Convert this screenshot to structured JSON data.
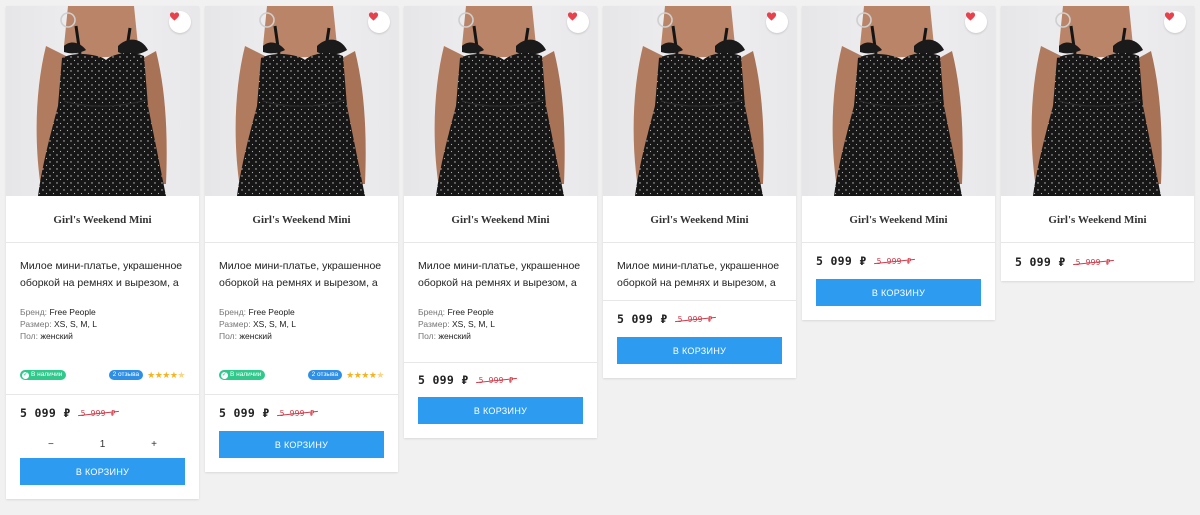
{
  "colors": {
    "accent": "#2d9cf0",
    "old_price": "#d13b4a",
    "in_stock": "#2fc98b",
    "reviews_badge": "#2d8fe6",
    "heart": "#e8414e",
    "stars": "#f5b320"
  },
  "icons": {
    "favorite": "heart-icon",
    "in_stock": "check-circle-icon",
    "rating": "star-icon"
  },
  "products": [
    {
      "title": "Girl's Weekend Mini",
      "description": "Милое мини-платье, украшенное оборкой на ремнях и вырезом, а",
      "brand_label": "Бренд:",
      "brand": "Free People",
      "size_label": "Размер:",
      "sizes": "XS, S, M, L",
      "gender_label": "Пол:",
      "gender": "женский",
      "in_stock": "В наличии",
      "reviews": "2 отзыва",
      "rating": 4.5,
      "price": "5 099 ₽",
      "old_price": "5 999 ₽",
      "qty_minus": "−",
      "qty_value": "1",
      "qty_plus": "+",
      "cart_label": "В КОРЗИНУ"
    },
    {
      "title": "Girl's Weekend Mini",
      "description": "Милое мини-платье, украшенное оборкой на ремнях и вырезом, а",
      "brand_label": "Бренд:",
      "brand": "Free People",
      "size_label": "Размер:",
      "sizes": "XS, S, M, L",
      "gender_label": "Пол:",
      "gender": "женский",
      "in_stock": "В наличии",
      "reviews": "2 отзыва",
      "rating": 4.5,
      "price": "5 099 ₽",
      "old_price": "5 999 ₽",
      "cart_label": "В КОРЗИНУ"
    },
    {
      "title": "Girl's Weekend Mini",
      "description": "Милое мини-платье, украшенное оборкой на ремнях и вырезом, а",
      "brand_label": "Бренд:",
      "brand": "Free People",
      "size_label": "Размер:",
      "sizes": "XS, S, M, L",
      "gender_label": "Пол:",
      "gender": "женский",
      "price": "5 099 ₽",
      "old_price": "5 999 ₽",
      "cart_label": "В КОРЗИНУ"
    },
    {
      "title": "Girl's Weekend Mini",
      "description": "Милое мини-платье, украшенное оборкой на ремнях и вырезом, а",
      "price": "5 099 ₽",
      "old_price": "5 999 ₽",
      "cart_label": "В КОРЗИНУ"
    },
    {
      "title": "Girl's Weekend Mini",
      "price": "5 099 ₽",
      "old_price": "5 999 ₽",
      "cart_label": "В КОРЗИНУ"
    },
    {
      "title": "Girl's Weekend Mini",
      "price": "5 099 ₽",
      "old_price": "5 999 ₽"
    }
  ]
}
